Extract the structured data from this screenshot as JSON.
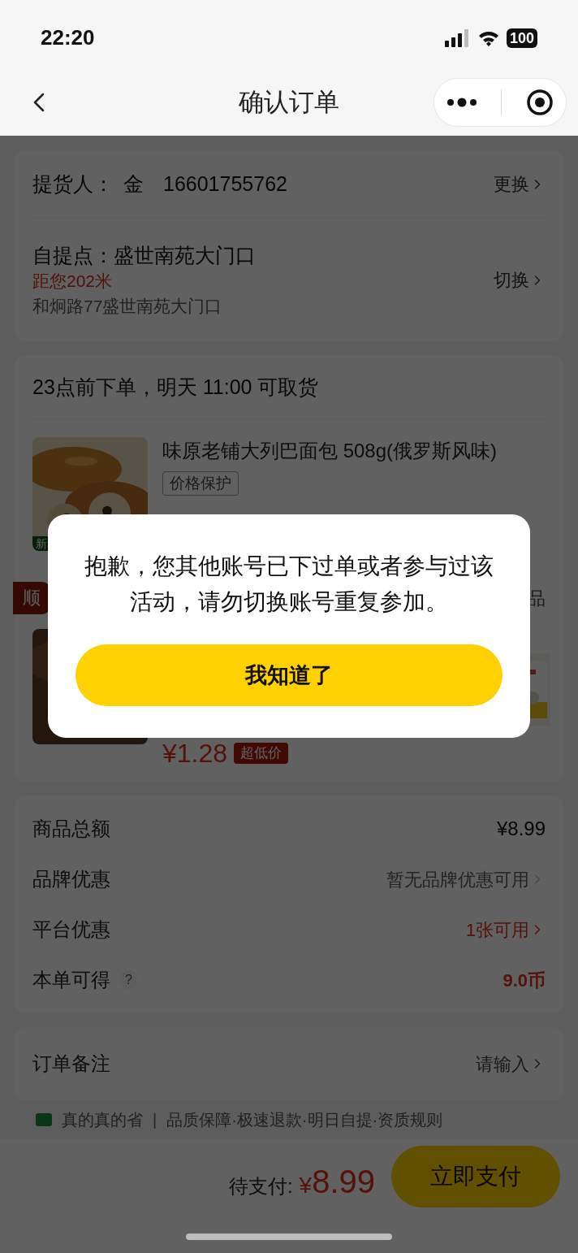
{
  "status_bar": {
    "time": "22:20",
    "battery": "100"
  },
  "nav": {
    "title": "确认订单"
  },
  "pickup": {
    "person_label": "提货人：",
    "person_name": "金",
    "phone": "16601755762",
    "person_action": "更换",
    "point_label": "自提点：盛世南苑大门口",
    "distance": "距您202米",
    "address": "和炯路77盛世南苑大门口",
    "point_action": "切换"
  },
  "delivery": {
    "notice": "23点前下单，明天 11:00 可取货",
    "product": {
      "name": "味原老铺大列巴面包 508g(俄罗斯风味)",
      "tag": "价格保护",
      "badge": "新"
    },
    "group_tag": "顺",
    "group_right": "品",
    "product_2": {
      "price": "¥1.28",
      "price_tag": "超低价"
    }
  },
  "summary": [
    {
      "label": "商品总额",
      "value": "¥8.99",
      "kind": "plain"
    },
    {
      "label": "品牌优惠",
      "value": "暂无品牌优惠可用",
      "kind": "muted_link"
    },
    {
      "label": "平台优惠",
      "value": "1张可用",
      "kind": "red_link"
    },
    {
      "label": "本单可得",
      "help": "?",
      "value": "9.0币",
      "kind": "coins"
    }
  ],
  "remark": {
    "label": "订单备注",
    "action": "请输入"
  },
  "footer_line": {
    "brand": "真的真的省",
    "separator": "|",
    "items": "品质保障·极速退款·明日自提·资质规则"
  },
  "bottom_bar": {
    "label": "待支付:",
    "currency": "¥",
    "amount": "8.99",
    "button": "立即支付"
  },
  "dialog": {
    "message": "抱歉，您其他账号已下过单或者参与过该活动，请勿切换账号重复参加。",
    "button": "我知道了"
  }
}
